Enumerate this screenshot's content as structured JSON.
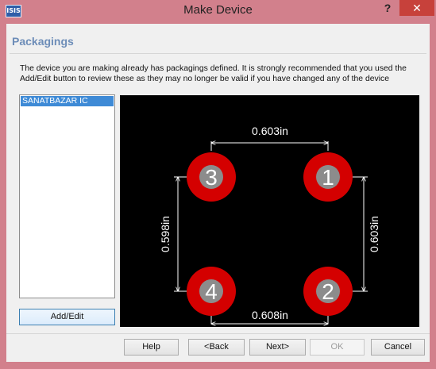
{
  "window": {
    "title": "Make Device",
    "app_icon": "ISIS",
    "help_glyph": "?",
    "close_glyph": "✕"
  },
  "section": {
    "title": "Packagings",
    "description": "The device you are making already has packagings defined. It is strongly recommended that you used the Add/Edit button to review these as they may no longer be valid if you have changed any of the device"
  },
  "packagings": {
    "items": [
      "SANATBAZAR IC"
    ],
    "selected": "SANATBAZAR IC",
    "add_edit_label": "Add/Edit"
  },
  "preview": {
    "pins": [
      "1",
      "2",
      "3",
      "4"
    ],
    "dimensions": {
      "top": "0.603in",
      "bottom": "0.608in",
      "left": "0.598in",
      "right": "0.603in"
    },
    "colors": {
      "background": "#000000",
      "pad": "#d40000",
      "hole": "#8c8c8c",
      "pin_label": "#ffffff",
      "dimension": "#ffffff"
    }
  },
  "buttons": {
    "help": "Help",
    "back": "<Back",
    "next": "Next>",
    "ok": "OK",
    "cancel": "Cancel"
  }
}
